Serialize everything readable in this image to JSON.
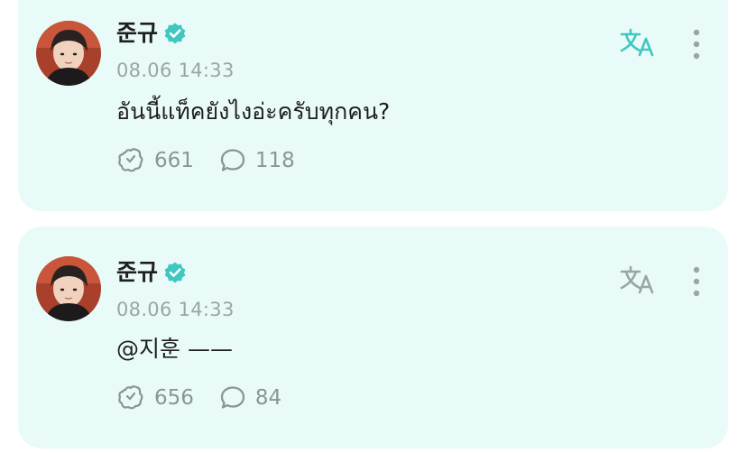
{
  "posts": [
    {
      "author": "준규",
      "timestamp": "08.06 14:33",
      "text": "อันนี้แท็คยังไงอ่ะครับทุกคน?",
      "reactions": "661",
      "comments": "118",
      "avatar_icon": "user-avatar",
      "verified_icon": "verified-badge-icon",
      "translate_icon": "translate-icon",
      "more_icon": "more-vertical-icon",
      "translate_color": "#3fc7c0"
    },
    {
      "author": "준규",
      "timestamp": "08.06 14:33",
      "text": "@지훈 ——",
      "reactions": "656",
      "comments": "84",
      "avatar_icon": "user-avatar",
      "verified_icon": "verified-badge-icon",
      "translate_icon": "translate-icon",
      "more_icon": "more-vertical-icon",
      "translate_color": "#9aa6a4"
    }
  ],
  "colors": {
    "card_background": "#e9fbf8",
    "accent": "#3fc7c0",
    "text": "#1e1e1e",
    "muted": "#9aa6a4"
  }
}
